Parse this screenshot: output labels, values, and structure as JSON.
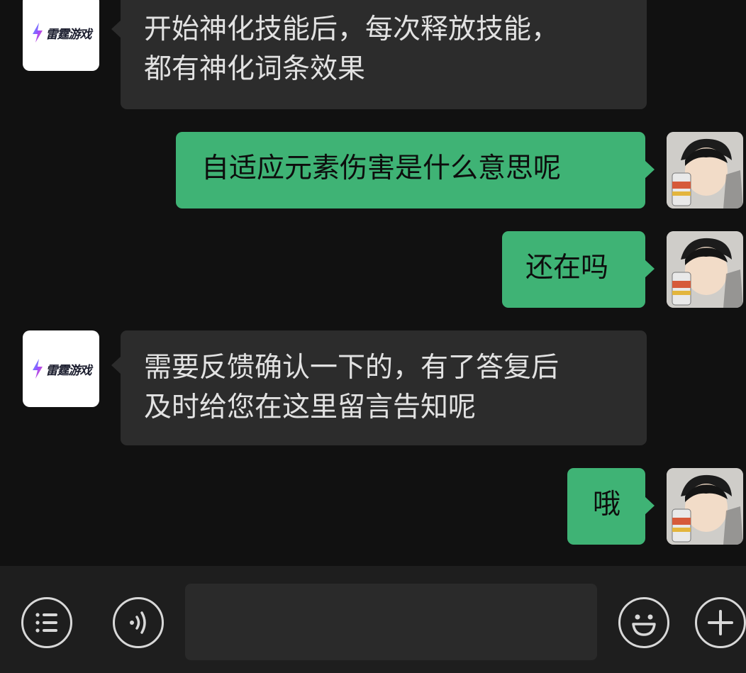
{
  "contacts": {
    "brand": {
      "name": "雷霆游戏"
    }
  },
  "messages": [
    {
      "from": "other",
      "lines": [
        "开始神化技能后，每次释放技能，",
        "都有神化词条效果"
      ]
    },
    {
      "from": "me",
      "lines": [
        "自适应元素伤害是什么意思呢"
      ]
    },
    {
      "from": "me",
      "lines": [
        "还在吗"
      ]
    },
    {
      "from": "other",
      "lines": [
        "需要反馈确认一下的，有了答复后",
        "及时给您在这里留言告知呢"
      ]
    },
    {
      "from": "me",
      "lines": [
        "哦"
      ]
    }
  ],
  "input": {
    "value": ""
  },
  "colors": {
    "background": "#111111",
    "incoming_bubble": "#2c2c2c",
    "outgoing_bubble": "#3fb375",
    "toolbar": "#1e1e1e"
  },
  "icons": {
    "menu": "list-icon",
    "voice": "voice-icon",
    "emoji": "emoji-icon",
    "add": "plus-icon"
  }
}
